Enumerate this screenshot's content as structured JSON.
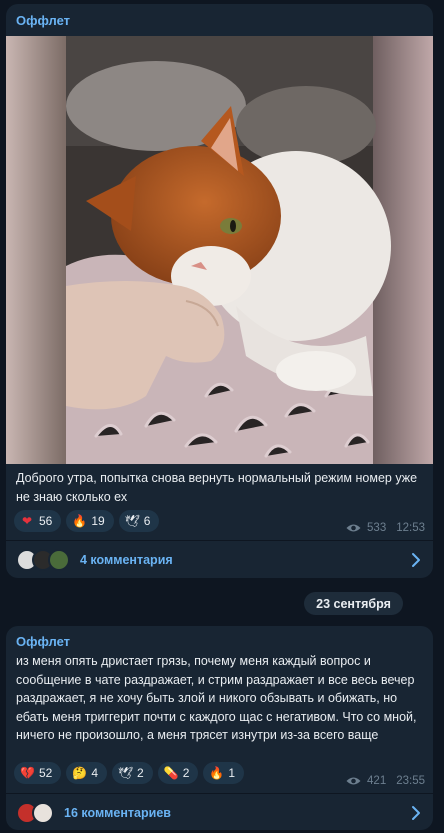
{
  "date_separator": "23 сентября",
  "posts": [
    {
      "channel": "Оффлет",
      "caption": "Доброго утра, попытка снова вернуть нормальный режим номер уже не знаю сколько ех",
      "reactions": [
        {
          "emoji": "❤",
          "count": "56",
          "icon": "red-heart-icon"
        },
        {
          "emoji": "🔥",
          "count": "19",
          "icon": "fire-icon"
        },
        {
          "emoji": "🕊",
          "count": "6",
          "icon": "dove-icon"
        }
      ],
      "views": "533",
      "time": "12:53",
      "comments": "4 комментария",
      "photo_description_icon": "cat-photo"
    },
    {
      "channel": "Оффлет",
      "caption": "из меня опять дристает грязь, почему меня каждый вопрос и сообщение в чате раздражает, и стрим раздражает и все весь вечер раздражает, я не хочу быть злой и никого обзывать и обижать, но ебать меня триггерит почти с каждого щас с негативом. Что со мной, ничего не произошло, а меня трясет изнутри из-за всего ваще",
      "reactions": [
        {
          "emoji": "💔",
          "count": "52",
          "icon": "broken-heart-icon"
        },
        {
          "emoji": "🤔",
          "count": "4",
          "icon": "thinking-face-icon"
        },
        {
          "emoji": "🕊",
          "count": "2",
          "icon": "dove-icon"
        },
        {
          "emoji": "💊",
          "count": "2",
          "icon": "pill-icon"
        },
        {
          "emoji": "🔥",
          "count": "1",
          "icon": "fire-icon"
        }
      ],
      "views": "421",
      "time": "23:55",
      "comments": "16 комментариев"
    }
  ],
  "colors": {
    "background": "#0e1621",
    "bubble": "#182533",
    "accent": "#6ab3f3",
    "muted": "#6d7f8f",
    "reaction_bg": "#1f3548"
  }
}
